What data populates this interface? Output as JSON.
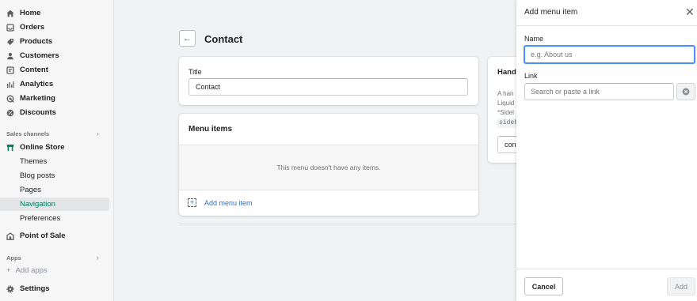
{
  "sidebar": {
    "items": [
      {
        "label": "Home",
        "icon": "home-icon"
      },
      {
        "label": "Orders",
        "icon": "orders-icon"
      },
      {
        "label": "Products",
        "icon": "tag-icon"
      },
      {
        "label": "Customers",
        "icon": "customer-icon"
      },
      {
        "label": "Content",
        "icon": "content-icon"
      },
      {
        "label": "Analytics",
        "icon": "analytics-icon"
      },
      {
        "label": "Marketing",
        "icon": "marketing-icon"
      },
      {
        "label": "Discounts",
        "icon": "discount-icon"
      }
    ],
    "sales_channels_label": "Sales channels",
    "online_store": {
      "label": "Online Store",
      "icon": "store-icon"
    },
    "online_store_sub": [
      {
        "label": "Themes"
      },
      {
        "label": "Blog posts"
      },
      {
        "label": "Pages"
      },
      {
        "label": "Navigation",
        "active": true
      },
      {
        "label": "Preferences"
      }
    ],
    "point_of_sale": {
      "label": "Point of Sale",
      "icon": "pos-icon"
    },
    "apps_label": "Apps",
    "add_apps": "Add apps",
    "settings": {
      "label": "Settings",
      "icon": "gear-icon"
    }
  },
  "page": {
    "title": "Contact",
    "title_card": {
      "label": "Title",
      "value": "Contact"
    },
    "menu_items_card": {
      "heading": "Menu items",
      "empty_text": "This menu doesn't have any items.",
      "add_label": "Add menu item"
    },
    "handle_card": {
      "heading": "Hand",
      "lines": [
        "A han",
        "Liquid",
        "*Sidel",
        "sideb"
      ],
      "input_value": "con"
    }
  },
  "panel": {
    "title": "Add menu item",
    "name_label": "Name",
    "name_placeholder": "e.g. About us",
    "link_label": "Link",
    "link_placeholder": "Search or paste a link",
    "cancel": "Cancel",
    "add": "Add"
  },
  "colors": {
    "accent": "#008060",
    "link": "#2c6ecb",
    "focus": "#458fff"
  }
}
